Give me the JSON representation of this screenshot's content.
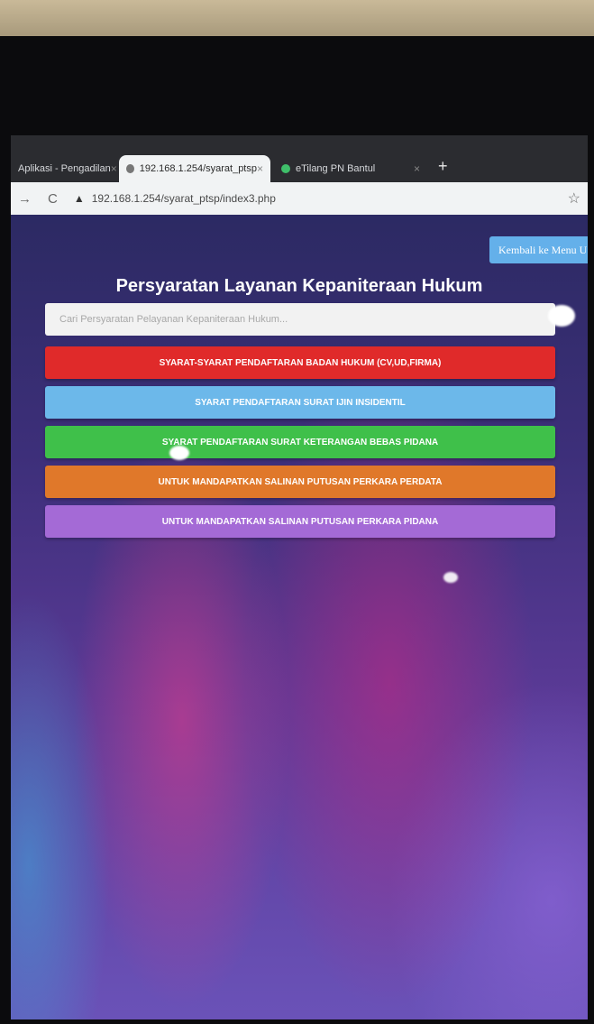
{
  "browser": {
    "tabs": [
      {
        "label": "Aplikasi - Pengadilan",
        "active": false
      },
      {
        "label": "192.168.1.254/syarat_ptsp",
        "active": true
      },
      {
        "label": "eTilang PN Bantul",
        "active": false
      }
    ],
    "new_tab_symbol": "+",
    "close_symbol": "×",
    "url": "192.168.1.254/syarat_ptsp/index3.php"
  },
  "page": {
    "back_button": "Kembali ke Menu U",
    "title": "Persyaratan Layanan Kepaniteraan Hukum",
    "search_placeholder": "Cari Persyaratan Pelayanan Kepaniteraan Hukum...",
    "requirements": [
      {
        "label": "SYARAT-SYARAT PENDAFTARAN BADAN HUKUM (CV,UD,FIRMA)",
        "color": "#e02a2a"
      },
      {
        "label": "SYARAT PENDAFTARAN SURAT IJIN INSIDENTIL",
        "color": "#6cb8ea"
      },
      {
        "label": "SYARAT PENDAFTARAN SURAT KETERANGAN BEBAS PIDANA",
        "color": "#3fc04a"
      },
      {
        "label": "UNTUK MANDAPATKAN SALINAN PUTUSAN PERKARA PERDATA",
        "color": "#e0782a"
      },
      {
        "label": "UNTUK MANDAPATKAN SALINAN PUTUSAN PERKARA PIDANA",
        "color": "#a46ad6"
      }
    ]
  }
}
